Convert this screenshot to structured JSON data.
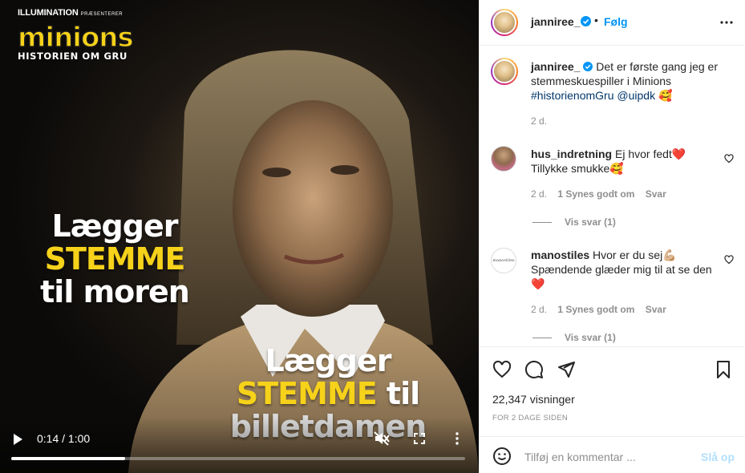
{
  "video": {
    "brand_studio": "ILLUMINATION",
    "brand_presents": "PRÆSENTERER",
    "brand_logo": "minions",
    "brand_subtitle": "HISTORIEN OM GRU",
    "caption1": {
      "line1": "Lægger",
      "line2": "STEMME",
      "line3": "til moren"
    },
    "caption2": {
      "line1": "Lægger",
      "line2a": "STEMME",
      "line2b": "til",
      "line3": "billetdamen"
    },
    "time": "0:14 / 1:00",
    "progress": 0.25
  },
  "header": {
    "username": "janniree_",
    "dot": "•",
    "follow": "Følg"
  },
  "post": {
    "username": "janniree_",
    "text_line1": "Det er første gang jeg er",
    "text_line2": "stemmeskuespiller i Minions",
    "hashtag": "#historienomGru",
    "mention": "@uipdk",
    "emoji": "🥰",
    "age": "2 d."
  },
  "comments": [
    {
      "username": "hus_indretning",
      "text_line1": "Ej hvor fedt",
      "emoji1": "❤️",
      "text_line2": "Tillykke smukke",
      "emoji2": "🥰",
      "age": "2 d.",
      "likes": "1 Synes godt om",
      "reply": "Svar",
      "view_replies": "Vis svar (1)"
    },
    {
      "username": "manostiles",
      "text_line1": "Hvor er du sej",
      "emoji1": "💪🏼",
      "text_line2": "Spændende glæder mig til at se den",
      "emoji2": "❤️",
      "age": "2 d.",
      "likes": "1 Synes godt om",
      "reply": "Svar",
      "view_replies": "Vis svar (1)",
      "avatar_text": "manostiles"
    }
  ],
  "stats": {
    "views": "22,347 visninger",
    "posted": "FOR 2 DAGE SIDEN"
  },
  "compose": {
    "placeholder": "Tilføj en kommentar ...",
    "post_label": "Slå op"
  },
  "colors": {
    "accent": "#0095f6",
    "minions_yellow": "#f6d21a",
    "like_red": "#ed4956"
  }
}
